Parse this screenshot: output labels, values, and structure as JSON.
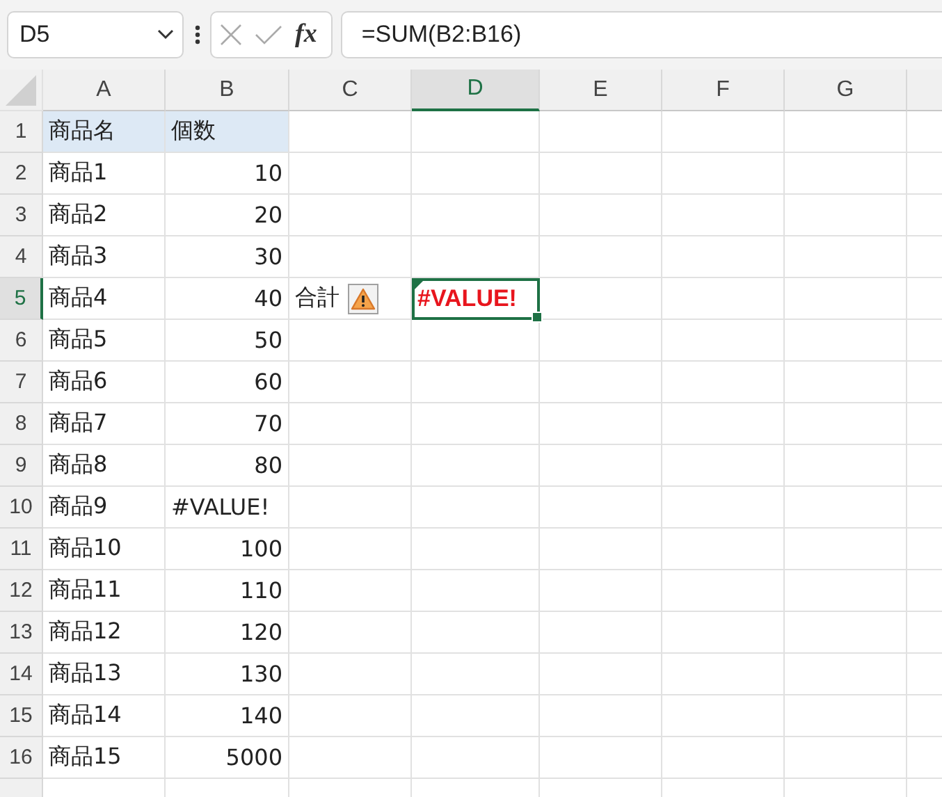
{
  "formula_bar": {
    "name_box": "D5",
    "function_button": "fx",
    "formula": "=SUM(B2:B16)"
  },
  "columns": [
    {
      "label": "A",
      "selected": false
    },
    {
      "label": "B",
      "selected": false
    },
    {
      "label": "C",
      "selected": false
    },
    {
      "label": "D",
      "selected": true
    },
    {
      "label": "E",
      "selected": false
    },
    {
      "label": "F",
      "selected": false
    },
    {
      "label": "G",
      "selected": false
    }
  ],
  "rows": [
    {
      "label": "1",
      "selected": false,
      "cells": [
        {
          "text": "商品名",
          "kind": "text",
          "highlighted": true
        },
        {
          "text": "個数",
          "kind": "text",
          "highlighted": true
        }
      ]
    },
    {
      "label": "2",
      "selected": false,
      "cells": [
        {
          "text": "商品1",
          "kind": "text"
        },
        {
          "text": "10",
          "kind": "number"
        }
      ]
    },
    {
      "label": "3",
      "selected": false,
      "cells": [
        {
          "text": "商品2",
          "kind": "text"
        },
        {
          "text": "20",
          "kind": "number"
        }
      ]
    },
    {
      "label": "4",
      "selected": false,
      "cells": [
        {
          "text": "商品3",
          "kind": "text"
        },
        {
          "text": "30",
          "kind": "number"
        }
      ]
    },
    {
      "label": "5",
      "selected": true,
      "cells": [
        {
          "text": "商品4",
          "kind": "text"
        },
        {
          "text": "40",
          "kind": "number"
        },
        {
          "text": "合計",
          "kind": "text",
          "warning": true
        },
        {
          "text": "#VALUE!",
          "kind": "error",
          "selected": true
        }
      ]
    },
    {
      "label": "6",
      "selected": false,
      "cells": [
        {
          "text": "商品5",
          "kind": "text"
        },
        {
          "text": "50",
          "kind": "number"
        }
      ]
    },
    {
      "label": "7",
      "selected": false,
      "cells": [
        {
          "text": "商品6",
          "kind": "text"
        },
        {
          "text": "60",
          "kind": "number"
        }
      ]
    },
    {
      "label": "8",
      "selected": false,
      "cells": [
        {
          "text": "商品7",
          "kind": "text"
        },
        {
          "text": "70",
          "kind": "number"
        }
      ]
    },
    {
      "label": "9",
      "selected": false,
      "cells": [
        {
          "text": "商品8",
          "kind": "text"
        },
        {
          "text": "80",
          "kind": "number"
        }
      ]
    },
    {
      "label": "10",
      "selected": false,
      "cells": [
        {
          "text": "商品9",
          "kind": "text"
        },
        {
          "text": "#VALUE!",
          "kind": "text"
        }
      ]
    },
    {
      "label": "11",
      "selected": false,
      "cells": [
        {
          "text": "商品10",
          "kind": "text"
        },
        {
          "text": "100",
          "kind": "number"
        }
      ]
    },
    {
      "label": "12",
      "selected": false,
      "cells": [
        {
          "text": "商品11",
          "kind": "text"
        },
        {
          "text": "110",
          "kind": "number"
        }
      ]
    },
    {
      "label": "13",
      "selected": false,
      "cells": [
        {
          "text": "商品12",
          "kind": "text"
        },
        {
          "text": "120",
          "kind": "number"
        }
      ]
    },
    {
      "label": "14",
      "selected": false,
      "cells": [
        {
          "text": "商品13",
          "kind": "text"
        },
        {
          "text": "130",
          "kind": "number"
        }
      ]
    },
    {
      "label": "15",
      "selected": false,
      "cells": [
        {
          "text": "商品14",
          "kind": "text"
        },
        {
          "text": "140",
          "kind": "number"
        }
      ]
    },
    {
      "label": "16",
      "selected": false,
      "cells": [
        {
          "text": "商品15",
          "kind": "text"
        },
        {
          "text": "5000",
          "kind": "number"
        }
      ]
    }
  ]
}
